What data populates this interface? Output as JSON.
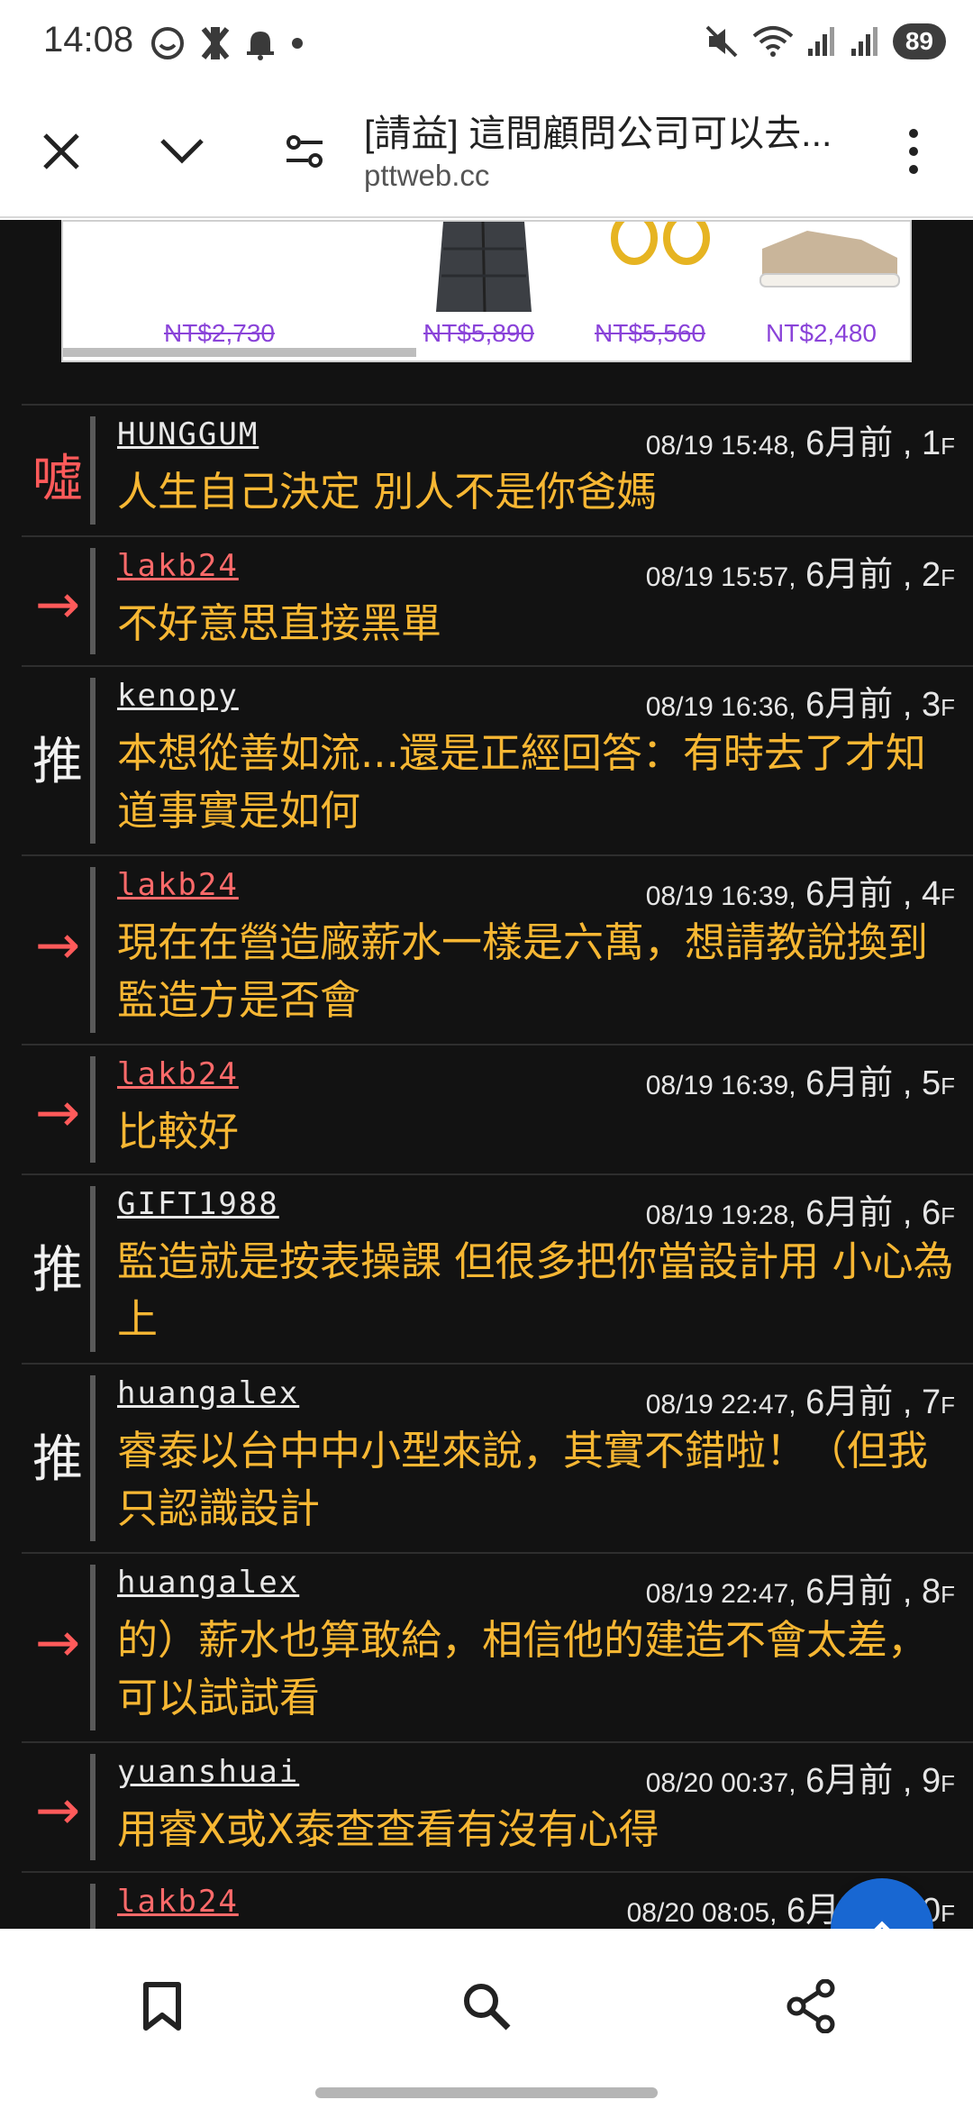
{
  "status_bar": {
    "time": "14:08",
    "battery": "89",
    "icons": [
      "face-icon",
      "x-app-icon",
      "notification-bell-icon",
      "dot-icon",
      "mute-icon",
      "wifi-icon",
      "signal-icon",
      "signal-icon-2"
    ]
  },
  "toolbar": {
    "title": "[請益] 這間顧問公司可以去...",
    "url": "pttweb.cc"
  },
  "ad": {
    "items": [
      {
        "price": "NT$2,730",
        "strike": true
      },
      {
        "price": "NT$5,890",
        "strike": true
      },
      {
        "price": "NT$5,560",
        "strike": true
      },
      {
        "price": "NT$2,480",
        "strike": false
      }
    ]
  },
  "comments": [
    {
      "tag": "噓",
      "type": "boo",
      "user": "HUNGGUM",
      "time": "08/19 15:48,",
      "ago": "6月前",
      "floor": "1",
      "text": "人生自己決定 別人不是你爸媽"
    },
    {
      "tag": "→",
      "type": "arrow",
      "user": "lakb24",
      "time": "08/19 15:57,",
      "ago": "6月前",
      "floor": "2",
      "text": "不好意思直接黑單"
    },
    {
      "tag": "推",
      "type": "push",
      "user": "kenopy",
      "time": "08/19 16:36,",
      "ago": "6月前",
      "floor": "3",
      "text": "本想從善如流...還是正經回答：有時去了才知道事實是如何"
    },
    {
      "tag": "→",
      "type": "arrow",
      "user": "lakb24",
      "time": "08/19 16:39,",
      "ago": "6月前",
      "floor": "4",
      "text": "現在在營造廠薪水一樣是六萬，想請教說換到監造方是否會"
    },
    {
      "tag": "→",
      "type": "arrow",
      "user": "lakb24",
      "time": "08/19 16:39,",
      "ago": "6月前",
      "floor": "5",
      "text": "比較好"
    },
    {
      "tag": "推",
      "type": "push",
      "user": "GIFT1988",
      "time": "08/19 19:28,",
      "ago": "6月前",
      "floor": "6",
      "text": "監造就是按表操課 但很多把你當設計用 小心為上"
    },
    {
      "tag": "推",
      "type": "push",
      "user": "huangalex",
      "time": "08/19 22:47,",
      "ago": "6月前",
      "floor": "7",
      "text": "睿泰以台中中小型來說，其實不錯啦！（但我只認識設計"
    },
    {
      "tag": "→",
      "type": "arrow",
      "user": "huangalex",
      "time": "08/19 22:47,",
      "ago": "6月前",
      "floor": "8",
      "text": "的）薪水也算敢給，相信他的建造不會太差，可以試試看"
    },
    {
      "tag": "→",
      "type": "arrow",
      "user": "yuanshuai",
      "time": "08/20 00:37,",
      "ago": "6月前",
      "floor": "9",
      "text": "用睿X或X泰查查看有沒有心得"
    },
    {
      "tag": "→",
      "type": "arrow",
      "user": "lakb24",
      "time": "08/20 08:05,",
      "ago": "6月前",
      "floor": "10",
      "text": ""
    }
  ],
  "floor_suffix": "F",
  "comma": " , ",
  "colors": {
    "background": "#121212",
    "comment_text": "#f7b733",
    "red_user": "#ff6a6a",
    "fab": "#1867d2",
    "ad_price": "#8a43d9"
  }
}
